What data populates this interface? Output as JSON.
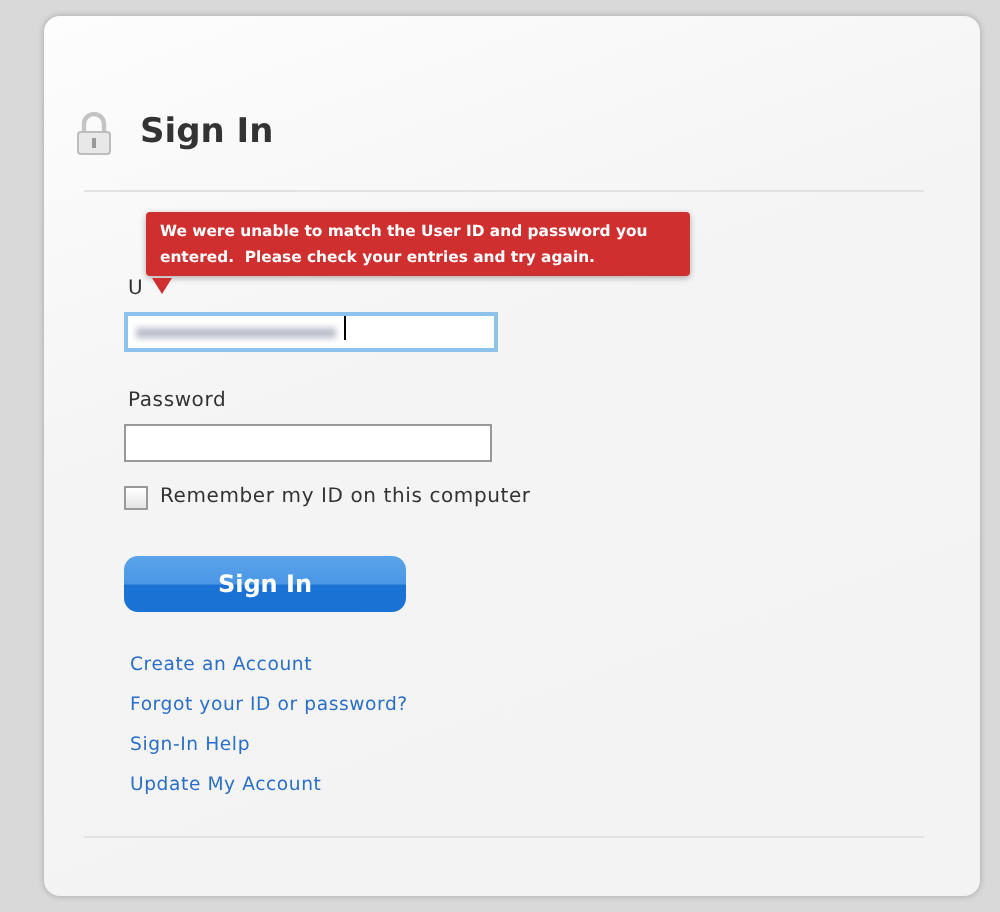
{
  "header": {
    "title": "Sign In"
  },
  "error_tooltip": {
    "text": "We were unable to match the User ID and password you entered.  Please check your entries and try again."
  },
  "fields": [
    {
      "label": "U",
      "kind": "text",
      "focused": true
    },
    {
      "label": "Password",
      "kind": "password",
      "focused": false
    }
  ],
  "remember": {
    "label": "Remember my ID on this computer",
    "checked": false
  },
  "submit": {
    "label": "Sign In"
  },
  "links": [
    "Create an Account",
    "Forgot your ID or password?",
    "Sign-In Help",
    "Update My Account"
  ]
}
